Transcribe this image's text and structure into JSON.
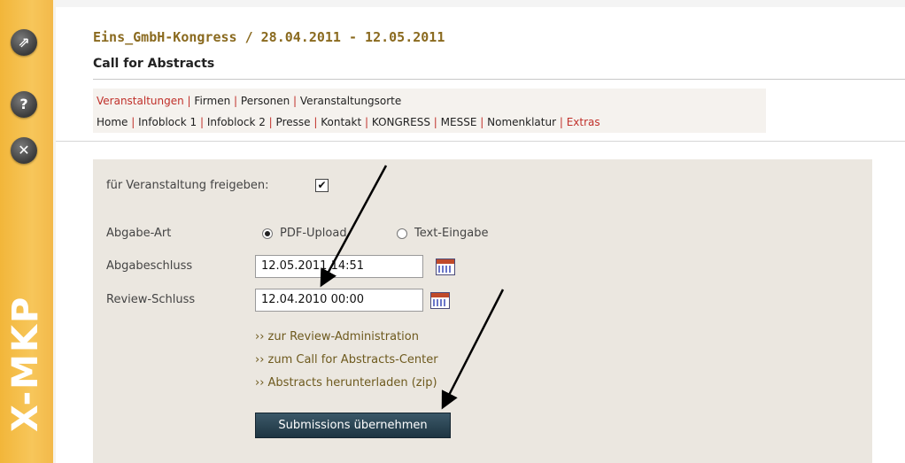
{
  "sidebar": {
    "buttons": [
      {
        "glyph": "⇗",
        "icon": "open-external-icon"
      },
      {
        "glyph": "?",
        "icon": "help-icon"
      },
      {
        "glyph": "✕",
        "icon": "close-icon"
      }
    ],
    "brand": "X-MKP"
  },
  "header": {
    "title": "Eins_GmbH-Kongress / 28.04.2011 - 12.05.2011",
    "subtitle": "Call for Abstracts"
  },
  "menu": {
    "row1": [
      "Veranstaltungen",
      "Firmen",
      "Personen",
      "Veranstaltungsorte"
    ],
    "row2": [
      "Home",
      "Infoblock 1",
      "Infoblock 2",
      "Presse",
      "Kontakt",
      "KONGRESS",
      "MESSE",
      "Nomenklatur",
      "Extras"
    ],
    "separator": "|"
  },
  "form": {
    "release_label": "für Veranstaltung freigeben:",
    "release_checked": "✔",
    "type_label": "Abgabe-Art",
    "type_options": [
      "PDF-Upload",
      "Text-Eingabe"
    ],
    "type_selected": "PDF-Upload",
    "deadline_label": "Abgabeschluss",
    "deadline_value": "12.05.2011 14:51",
    "review_label": "Review-Schluss",
    "review_value": "12.04.2010 00:00",
    "links": [
      "›› zur Review-Administration",
      "›› zum Call for Abstracts-Center",
      "›› Abstracts herunterladen (zip)"
    ],
    "submit_label": "Submissions übernehmen"
  },
  "colors": {
    "accent_red": "#c0302a",
    "title_brown": "#8a6a1f",
    "sidebar_orange": "#f7c65a",
    "button_dark": "#2a4656"
  }
}
